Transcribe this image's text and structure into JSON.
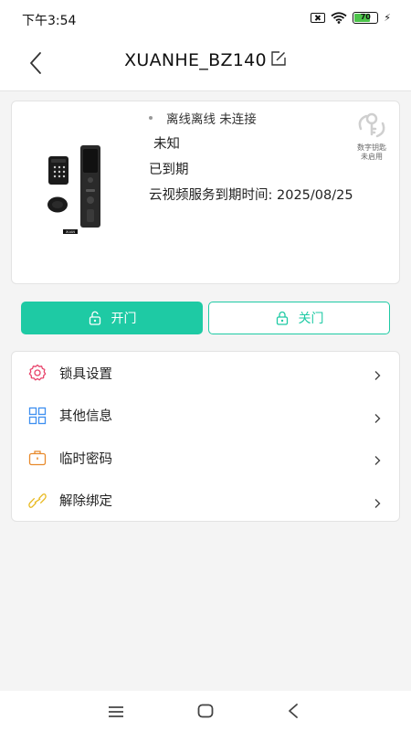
{
  "status_bar": {
    "time": "下午3:54",
    "battery_level": "70",
    "battery_percent": 70,
    "icons": [
      "sim-off-icon",
      "wifi-icon",
      "battery-icon",
      "charging-icon"
    ]
  },
  "header": {
    "title": "XUANHE_BZ140",
    "back_icon": "chevron-left-icon",
    "edit_icon": "edit-icon"
  },
  "device": {
    "connection_status": "离线离线 未连接",
    "state": "未知",
    "expiry_status": "已到期",
    "cloud_video_expiry": "云视频服务到期时间: 2025/08/25",
    "key_status_line1": "数字钥匙",
    "key_status_line2": "未启用",
    "image_label": "XUAN"
  },
  "actions": {
    "open_label": "开门",
    "close_label": "关门"
  },
  "menu": {
    "items": [
      {
        "label": "锁具设置",
        "icon": "gear-icon",
        "color": "#e8426a"
      },
      {
        "label": "其他信息",
        "icon": "grid-icon",
        "color": "#3d8ff0"
      },
      {
        "label": "临时密码",
        "icon": "briefcase-icon",
        "color": "#e88a2c"
      },
      {
        "label": "解除绑定",
        "icon": "link-icon",
        "color": "#e8b81c"
      }
    ]
  },
  "nav_bar": {
    "icons": [
      "menu-icon",
      "home-icon",
      "back-icon"
    ]
  },
  "colors": {
    "accent": "#1ecaa4",
    "background": "#f4f4f4"
  }
}
